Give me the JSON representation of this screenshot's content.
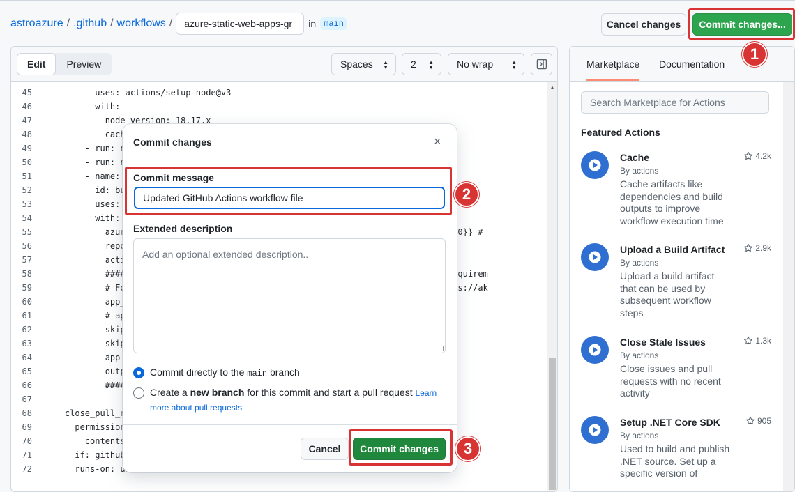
{
  "breadcrumb": {
    "owner": "astroazure",
    "folder1": ".github",
    "folder2": "workflows",
    "separator": "/",
    "filename_value": "azure-static-web-apps-gr",
    "in_label": "in",
    "branch": "main"
  },
  "header": {
    "cancel_label": "Cancel changes",
    "commit_label": "Commit changes..."
  },
  "editor": {
    "tab_edit": "Edit",
    "tab_preview": "Preview",
    "indent_mode": "Spaces",
    "indent_size": "2",
    "wrap_mode": "No wrap",
    "lines": [
      {
        "n": "45",
        "t": "        - uses: actions/setup-node@v3"
      },
      {
        "n": "46",
        "t": "          with:"
      },
      {
        "n": "47",
        "t": "            node-version: 18.17.x"
      },
      {
        "n": "48",
        "t": "            cache"
      },
      {
        "n": "49",
        "t": "        - run: np"
      },
      {
        "n": "50",
        "t": "        - run: np"
      },
      {
        "n": "51",
        "t": "        - name: B"
      },
      {
        "n": "52",
        "t": "          id: bui"
      },
      {
        "n": "53",
        "t": "          uses: A"
      },
      {
        "n": "54",
        "t": "          with:"
      },
      {
        "n": "55",
        "t": "            azure                                                    _SKY_05E527510}} #"
      },
      {
        "n": "56",
        "t": "            repo_                                                   PR comments)"
      },
      {
        "n": "57",
        "t": "            actic"
      },
      {
        "n": "58",
        "t": "            #####                                                   tch you app requirem"
      },
      {
        "n": "59",
        "t": "            # For                                                   se visit: https://ak"
      },
      {
        "n": "60",
        "t": "            app_l"
      },
      {
        "n": "61",
        "t": "            # api"
      },
      {
        "n": "62",
        "t": "            skip_"
      },
      {
        "n": "63",
        "t": "            skip_"
      },
      {
        "n": "64",
        "t": "            app_a"
      },
      {
        "n": "65",
        "t": "            outpu"
      },
      {
        "n": "66",
        "t": "            #####"
      },
      {
        "n": "67",
        "t": ""
      },
      {
        "n": "68",
        "t": "    close_pull_re"
      },
      {
        "n": "69",
        "t": "      permissions"
      },
      {
        "n": "70",
        "t": "        contents:"
      },
      {
        "n": "71",
        "t": "      if: github."
      },
      {
        "n": "72",
        "t": "      runs-on: ubu"
      }
    ]
  },
  "sidebar": {
    "tab_marketplace": "Marketplace",
    "tab_documentation": "Documentation",
    "search_placeholder": "Search Marketplace for Actions",
    "featured_title": "Featured Actions",
    "actions": [
      {
        "name": "Cache",
        "by": "By actions",
        "stars": "4.2k",
        "desc": "Cache artifacts like dependencies and build outputs to improve workflow execution time"
      },
      {
        "name": "Upload a Build Artifact",
        "by": "By actions",
        "stars": "2.9k",
        "desc": "Upload a build artifact that can be used by subsequent workflow steps"
      },
      {
        "name": "Close Stale Issues",
        "by": "By actions",
        "stars": "1.3k",
        "desc": "Close issues and pull requests with no recent activity"
      },
      {
        "name": "Setup .NET Core SDK",
        "by": "By actions",
        "stars": "905",
        "desc": "Used to build and publish .NET source. Set up a specific version of"
      }
    ]
  },
  "modal": {
    "title": "Commit changes",
    "close_glyph": "×",
    "message_label": "Commit message",
    "message_value": "Updated GitHub Actions workflow file",
    "extended_label": "Extended description",
    "extended_placeholder": "Add an optional extended description..",
    "option1_pre": "Commit directly to the ",
    "option1_code": "main",
    "option1_post": " branch",
    "option2_pre": "Create a ",
    "option2_bold": "new branch",
    "option2_post": " for this commit and start a pull request ",
    "option2_link1": "Learn",
    "option2_link2": "more about pull requests",
    "cancel_label": "Cancel",
    "commit_label": "Commit changes"
  },
  "annotations": {
    "one": "1",
    "two": "2",
    "three": "3",
    "color": "#d93434"
  },
  "colors": {
    "primary_green": "#2da44e",
    "link_blue": "#0969da",
    "tab_underline": "#fd8c73"
  }
}
